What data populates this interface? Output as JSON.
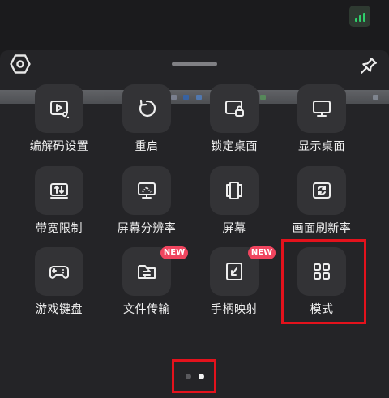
{
  "header": {
    "settings_icon": "hexagon-settings-icon",
    "drag_handle": "drag-handle",
    "pin_icon": "pin-icon",
    "signal_icon": "signal-strength-icon"
  },
  "grid": {
    "page1": [
      {
        "label": "编解码设置",
        "icon": "codec-settings-icon",
        "badge": ""
      },
      {
        "label": "重启",
        "icon": "restart-icon",
        "badge": ""
      },
      {
        "label": "锁定桌面",
        "icon": "lock-desktop-icon",
        "badge": ""
      },
      {
        "label": "显示桌面",
        "icon": "show-desktop-icon",
        "badge": ""
      },
      {
        "label": "带宽限制",
        "icon": "bandwidth-limit-icon",
        "badge": ""
      },
      {
        "label": "屏幕分辨率",
        "icon": "screen-resolution-icon",
        "badge": ""
      },
      {
        "label": "屏幕",
        "icon": "screen-icon",
        "badge": ""
      },
      {
        "label": "画面刷新率",
        "icon": "refresh-rate-icon",
        "badge": ""
      },
      {
        "label": "游戏键盘",
        "icon": "gamepad-icon",
        "badge": ""
      },
      {
        "label": "文件传输",
        "icon": "file-transfer-icon",
        "badge": "NEW"
      },
      {
        "label": "手柄映射",
        "icon": "controller-mapping-icon",
        "badge": "NEW"
      },
      {
        "label": "模式",
        "icon": "mode-grid-icon",
        "badge": ""
      }
    ]
  },
  "pagination": {
    "pages": 2,
    "current": 2
  },
  "colors": {
    "accent_highlight": "#e4121c",
    "badge": "#f0455f",
    "signal": "#2fcf6a"
  }
}
